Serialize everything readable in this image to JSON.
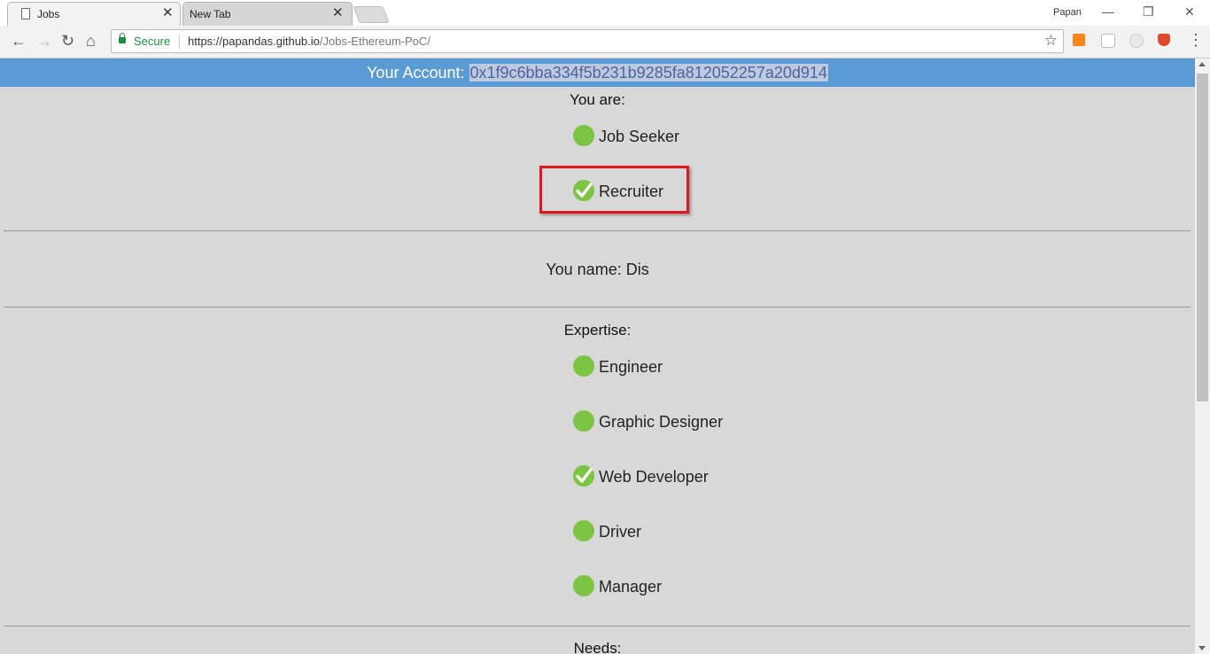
{
  "browser": {
    "tabs": [
      {
        "title": "Jobs",
        "close": "✕"
      },
      {
        "title": "New Tab",
        "close": "✕"
      }
    ],
    "profile": "Papan",
    "window_controls": {
      "minimize": "—",
      "restore": "❐",
      "close": "✕"
    },
    "nav": {
      "back": "←",
      "forward": "→",
      "reload": "↻",
      "home": "⌂"
    },
    "address": {
      "secure_label": "Secure",
      "url_host": "https://papandas.github.io",
      "url_path": "/Jobs-Ethereum-PoC/"
    },
    "bookmark_icon": "☆",
    "menu_icon": "⋮",
    "extensions": [
      "metamask-icon",
      "extension-gear-icon",
      "extension-circle-icon",
      "brave-shield-icon"
    ]
  },
  "account": {
    "label": "Your Account: ",
    "address": "0x1f9c6bba334f5b231b9285fa812052257a20d914"
  },
  "role": {
    "heading": "You are:",
    "options": [
      {
        "label": "Job Seeker",
        "checked": false
      },
      {
        "label": "Recruiter",
        "checked": true
      }
    ]
  },
  "name": {
    "text": "You name: Dis"
  },
  "expertise": {
    "heading": "Expertise:",
    "options": [
      {
        "label": "Engineer",
        "checked": false
      },
      {
        "label": "Graphic Designer",
        "checked": false
      },
      {
        "label": "Web Developer",
        "checked": true
      },
      {
        "label": "Driver",
        "checked": false
      },
      {
        "label": "Manager",
        "checked": false
      }
    ]
  },
  "needs": {
    "heading": "Needs:"
  },
  "colors": {
    "header_bar": "#5b9bd5",
    "radio": "#7cc443",
    "highlight": "#e4161b",
    "page_bg": "#d8d8d8"
  }
}
